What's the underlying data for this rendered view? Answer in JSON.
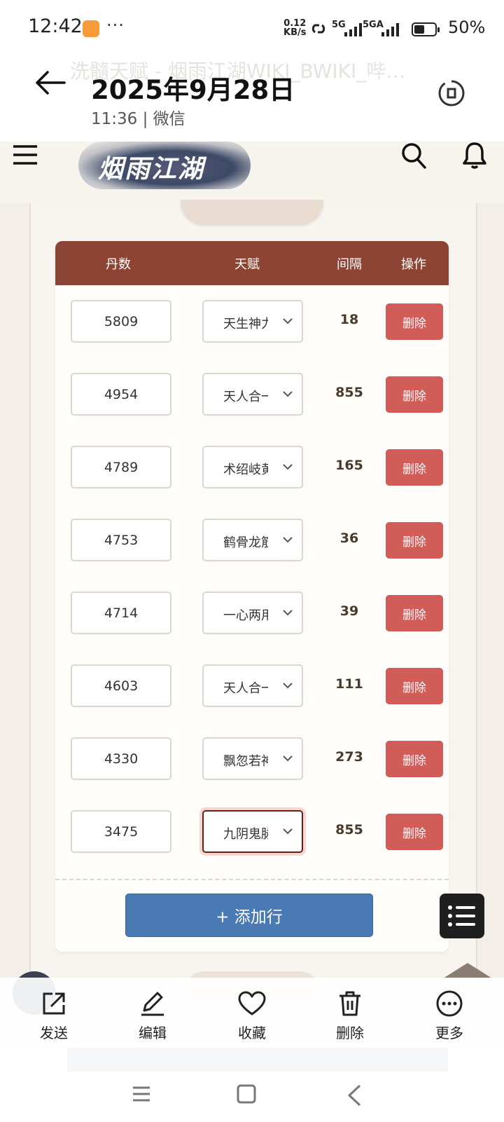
{
  "status_bar": {
    "time": "12:42",
    "more": "···",
    "net_speed": "0.12",
    "net_unit": "KB/s",
    "sig1": "5G",
    "sig2": "5GA",
    "battery_text": "50%",
    "battery_level": 0.5
  },
  "header": {
    "ghost_title": "洗髓天赋 - 烟雨江湖WIKI_BWIKI_哔…",
    "date": "2025年9月28日",
    "subtitle": "11:36 | 微信"
  },
  "site": {
    "logo_text": "烟雨江湖"
  },
  "table": {
    "columns": [
      "丹数",
      "天赋",
      "间隔",
      "操作"
    ],
    "rows": [
      {
        "dan": "5809",
        "talent": "天生神力",
        "interval": "18",
        "action": "删除"
      },
      {
        "dan": "4954",
        "talent": "天人合一",
        "interval": "855",
        "action": "删除"
      },
      {
        "dan": "4789",
        "talent": "术绍岐黄",
        "interval": "165",
        "action": "删除"
      },
      {
        "dan": "4753",
        "talent": "鹤骨龙筋",
        "interval": "36",
        "action": "删除"
      },
      {
        "dan": "4714",
        "talent": "一心两用",
        "interval": "39",
        "action": "删除"
      },
      {
        "dan": "4603",
        "talent": "天人合一",
        "interval": "111",
        "action": "删除"
      },
      {
        "dan": "4330",
        "talent": "飘忽若神",
        "interval": "273",
        "action": "删除"
      },
      {
        "dan": "3475",
        "talent": "九阴鬼脉",
        "interval": "855",
        "action": "删除"
      }
    ],
    "add_label": "+ 添加行"
  },
  "actions": [
    {
      "label": "发送",
      "icon": "share-icon"
    },
    {
      "label": "编辑",
      "icon": "pencil-icon"
    },
    {
      "label": "收藏",
      "icon": "heart-icon"
    },
    {
      "label": "删除",
      "icon": "trash-icon"
    },
    {
      "label": "更多",
      "icon": "more-icon"
    }
  ],
  "colors": {
    "header_brown": "#8c4535",
    "delete_red": "#d15c58",
    "add_blue": "#4a7ab3"
  }
}
